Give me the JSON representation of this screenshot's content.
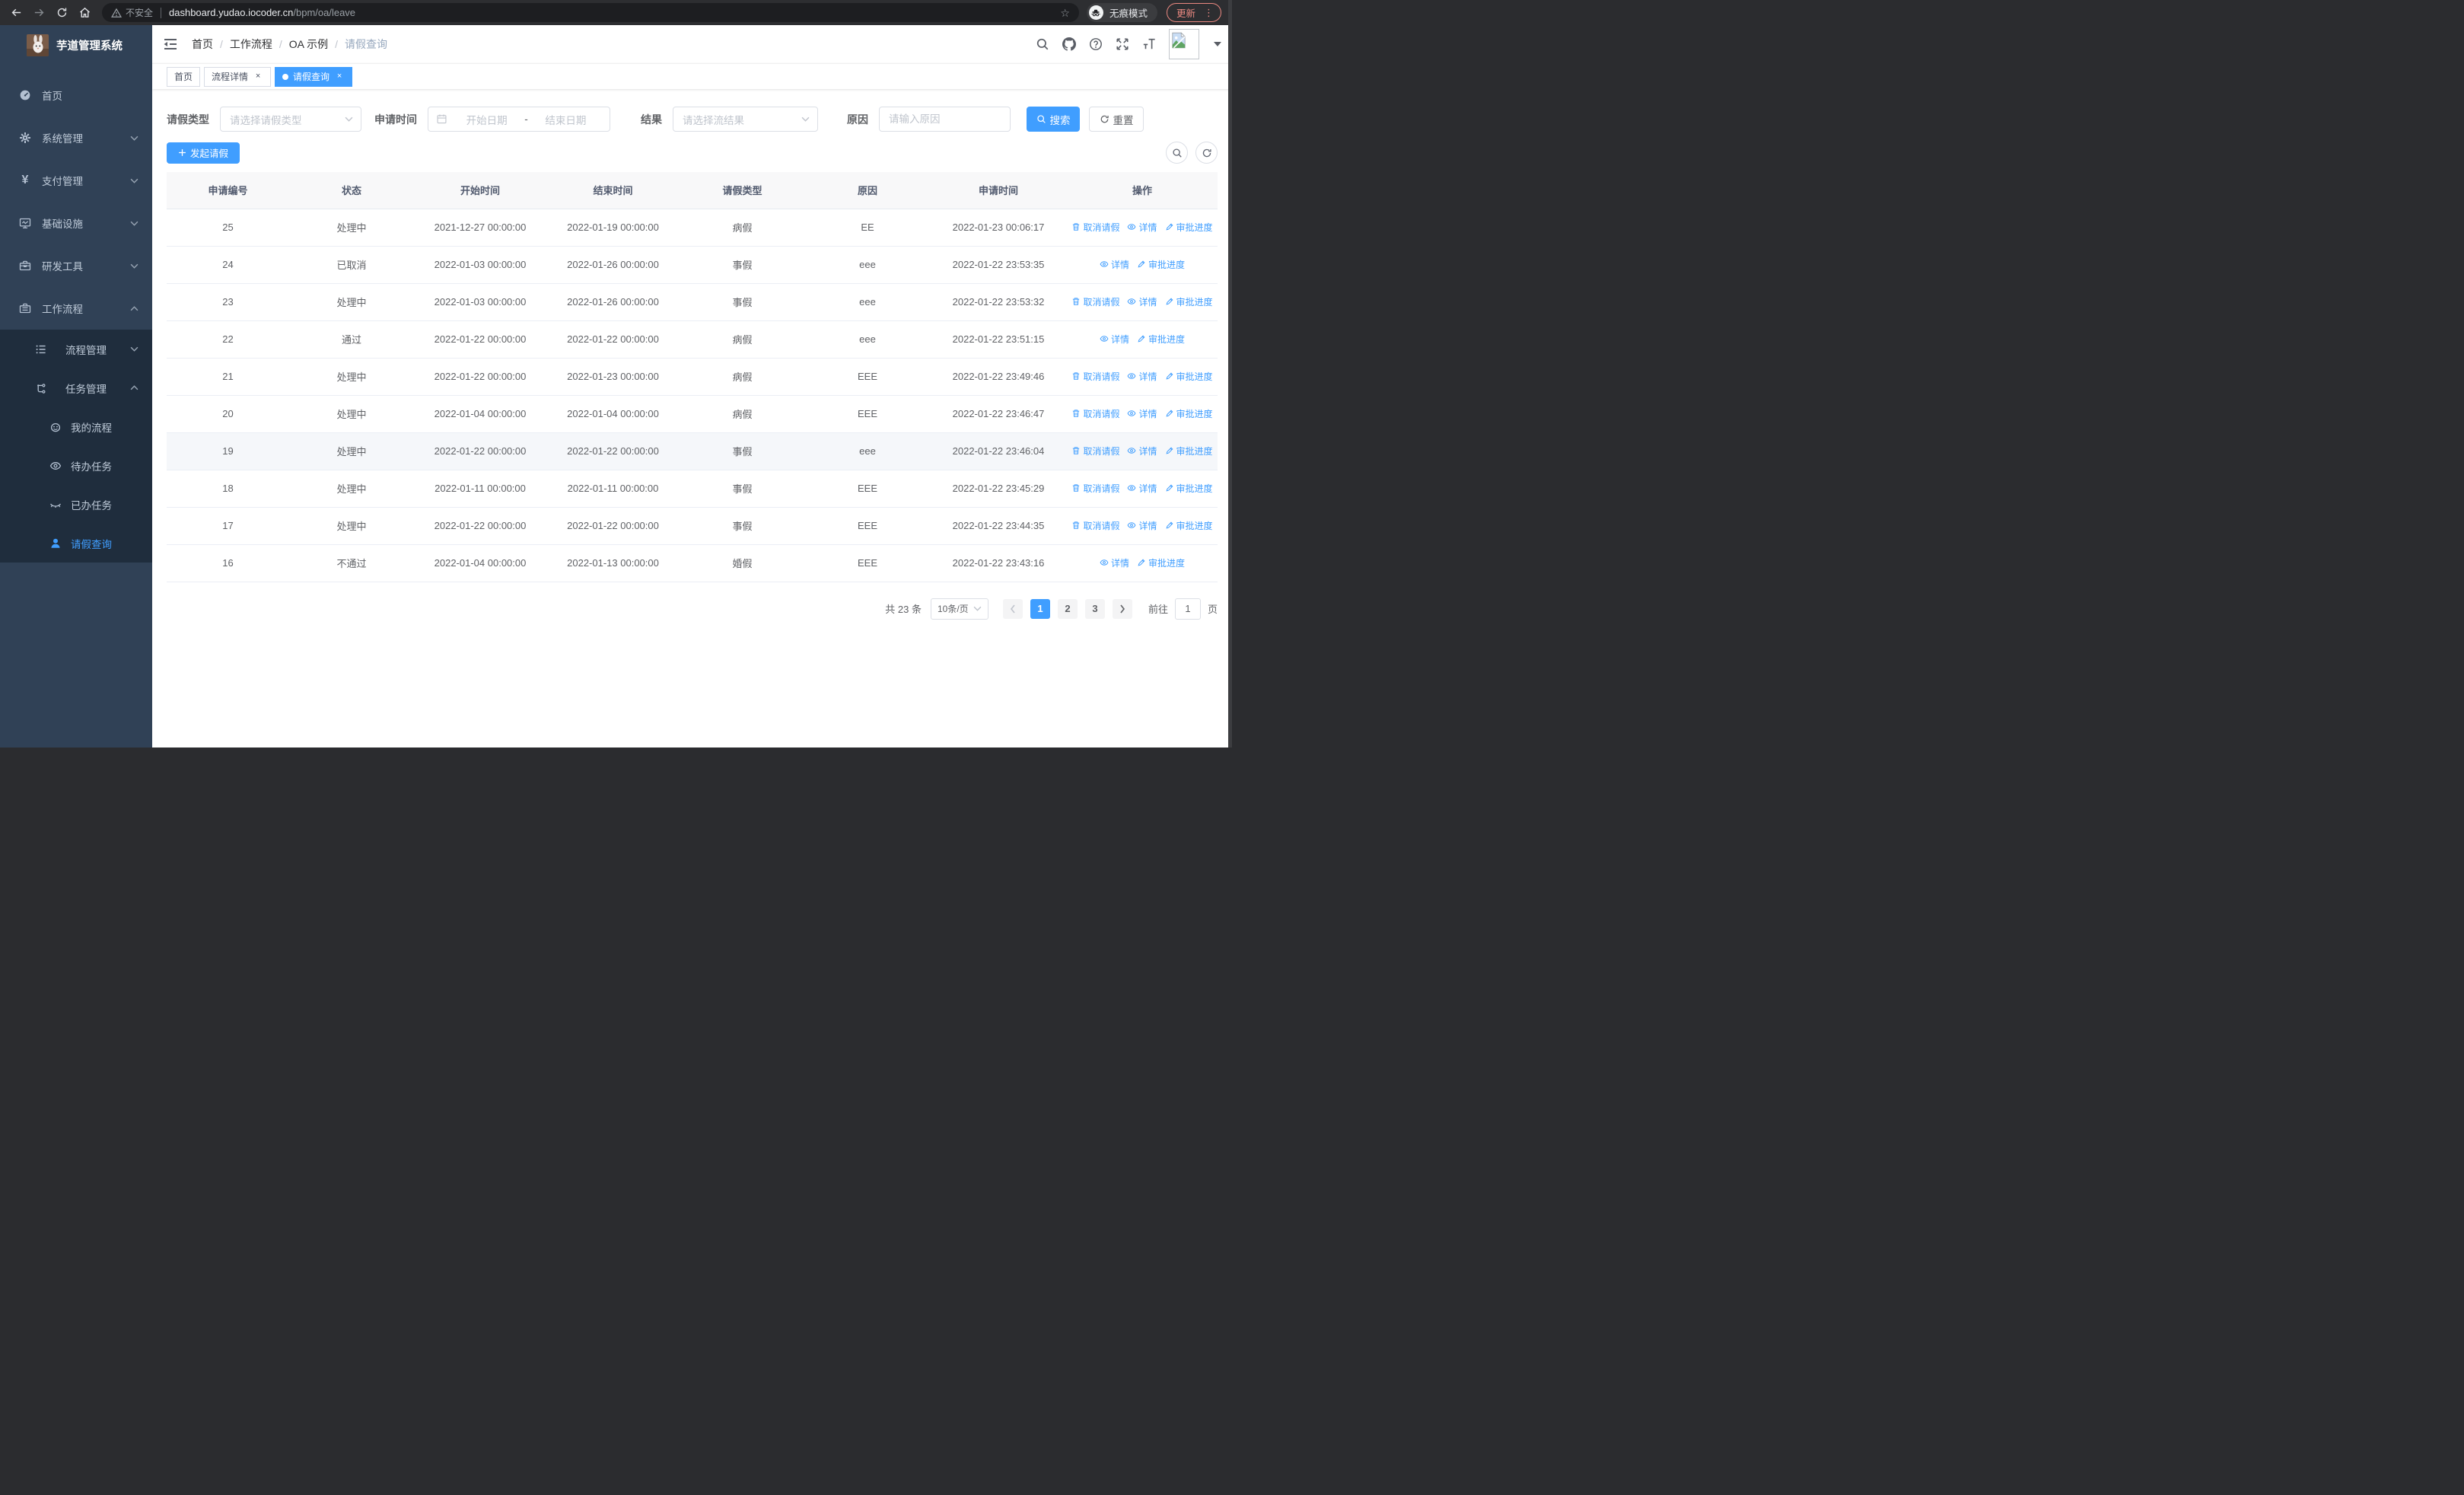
{
  "browser": {
    "not_secure_label": "不安全",
    "url_host": "dashboard.yudao.iocoder.cn",
    "url_path": "/bpm/oa/leave",
    "incognito_label": "无痕模式",
    "update_label": "更新"
  },
  "icons": {
    "star_glyph": "☆",
    "menu_dots_glyph": "⋮"
  },
  "sidebar": {
    "title": "芋道管理系统",
    "menu": [
      {
        "label": "首页"
      },
      {
        "label": "系统管理"
      },
      {
        "label": "支付管理"
      },
      {
        "label": "基础设施"
      },
      {
        "label": "研发工具"
      },
      {
        "label": "工作流程"
      }
    ],
    "submenu": [
      {
        "label": "流程管理"
      },
      {
        "label": "任务管理"
      }
    ],
    "children": [
      {
        "label": "我的流程"
      },
      {
        "label": "待办任务"
      },
      {
        "label": "已办任务"
      },
      {
        "label": "请假查询"
      }
    ]
  },
  "header": {
    "separator": "/",
    "breadcrumb": [
      "首页",
      "工作流程",
      "OA 示例",
      "请假查询"
    ]
  },
  "tabs": [
    {
      "label": "首页"
    },
    {
      "label": "流程详情"
    },
    {
      "label": "请假查询"
    }
  ],
  "filters": {
    "type_label": "请假类型",
    "type_placeholder": "请选择请假类型",
    "time_label": "申请时间",
    "start_placeholder": "开始日期",
    "range_separator": "-",
    "end_placeholder": "结束日期",
    "result_label": "结果",
    "result_placeholder": "请选择流结果",
    "reason_label": "原因",
    "reason_placeholder": "请输入原因",
    "search_label": "搜索",
    "reset_label": "重置"
  },
  "toolbar": {
    "create_label": "发起请假"
  },
  "table": {
    "columns": [
      "申请编号",
      "状态",
      "开始时间",
      "结束时间",
      "请假类型",
      "原因",
      "申请时间",
      "操作"
    ],
    "fields": [
      "id",
      "status",
      "start_time",
      "end_time",
      "leave_type",
      "reason",
      "apply_time"
    ],
    "action_defs": {
      "cancel": {
        "label": "取消请假",
        "icon": "trash-icon"
      },
      "detail": {
        "label": "详情",
        "icon": "eye-icon"
      },
      "progress": {
        "label": "审批进度",
        "icon": "edit-icon"
      }
    },
    "rows": [
      {
        "id": "25",
        "status": "处理中",
        "start_time": "2021-12-27 00:00:00",
        "end_time": "2022-01-19 00:00:00",
        "leave_type": "病假",
        "reason": "EE",
        "apply_time": "2022-01-23 00:06:17",
        "actions": [
          "cancel",
          "detail",
          "progress"
        ],
        "highlight": false
      },
      {
        "id": "24",
        "status": "已取消",
        "start_time": "2022-01-03 00:00:00",
        "end_time": "2022-01-26 00:00:00",
        "leave_type": "事假",
        "reason": "eee",
        "apply_time": "2022-01-22 23:53:35",
        "actions": [
          "detail",
          "progress"
        ],
        "highlight": false
      },
      {
        "id": "23",
        "status": "处理中",
        "start_time": "2022-01-03 00:00:00",
        "end_time": "2022-01-26 00:00:00",
        "leave_type": "事假",
        "reason": "eee",
        "apply_time": "2022-01-22 23:53:32",
        "actions": [
          "cancel",
          "detail",
          "progress"
        ],
        "highlight": false
      },
      {
        "id": "22",
        "status": "通过",
        "start_time": "2022-01-22 00:00:00",
        "end_time": "2022-01-22 00:00:00",
        "leave_type": "病假",
        "reason": "eee",
        "apply_time": "2022-01-22 23:51:15",
        "actions": [
          "detail",
          "progress"
        ],
        "highlight": false
      },
      {
        "id": "21",
        "status": "处理中",
        "start_time": "2022-01-22 00:00:00",
        "end_time": "2022-01-23 00:00:00",
        "leave_type": "病假",
        "reason": "EEE",
        "apply_time": "2022-01-22 23:49:46",
        "actions": [
          "cancel",
          "detail",
          "progress"
        ],
        "highlight": false
      },
      {
        "id": "20",
        "status": "处理中",
        "start_time": "2022-01-04 00:00:00",
        "end_time": "2022-01-04 00:00:00",
        "leave_type": "病假",
        "reason": "EEE",
        "apply_time": "2022-01-22 23:46:47",
        "actions": [
          "cancel",
          "detail",
          "progress"
        ],
        "highlight": false
      },
      {
        "id": "19",
        "status": "处理中",
        "start_time": "2022-01-22 00:00:00",
        "end_time": "2022-01-22 00:00:00",
        "leave_type": "事假",
        "reason": "eee",
        "apply_time": "2022-01-22 23:46:04",
        "actions": [
          "cancel",
          "detail",
          "progress"
        ],
        "highlight": true
      },
      {
        "id": "18",
        "status": "处理中",
        "start_time": "2022-01-11 00:00:00",
        "end_time": "2022-01-11 00:00:00",
        "leave_type": "事假",
        "reason": "EEE",
        "apply_time": "2022-01-22 23:45:29",
        "actions": [
          "cancel",
          "detail",
          "progress"
        ],
        "highlight": false
      },
      {
        "id": "17",
        "status": "处理中",
        "start_time": "2022-01-22 00:00:00",
        "end_time": "2022-01-22 00:00:00",
        "leave_type": "事假",
        "reason": "EEE",
        "apply_time": "2022-01-22 23:44:35",
        "actions": [
          "cancel",
          "detail",
          "progress"
        ],
        "highlight": false
      },
      {
        "id": "16",
        "status": "不通过",
        "start_time": "2022-01-04 00:00:00",
        "end_time": "2022-01-13 00:00:00",
        "leave_type": "婚假",
        "reason": "EEE",
        "apply_time": "2022-01-22 23:43:16",
        "actions": [
          "detail",
          "progress"
        ],
        "highlight": false
      }
    ]
  },
  "pagination": {
    "total_label": "共 23 条",
    "size_label": "10条/页",
    "pages": [
      "1",
      "2",
      "3"
    ],
    "goto_label": "前往",
    "jump_value": "1",
    "page_word": "页"
  }
}
